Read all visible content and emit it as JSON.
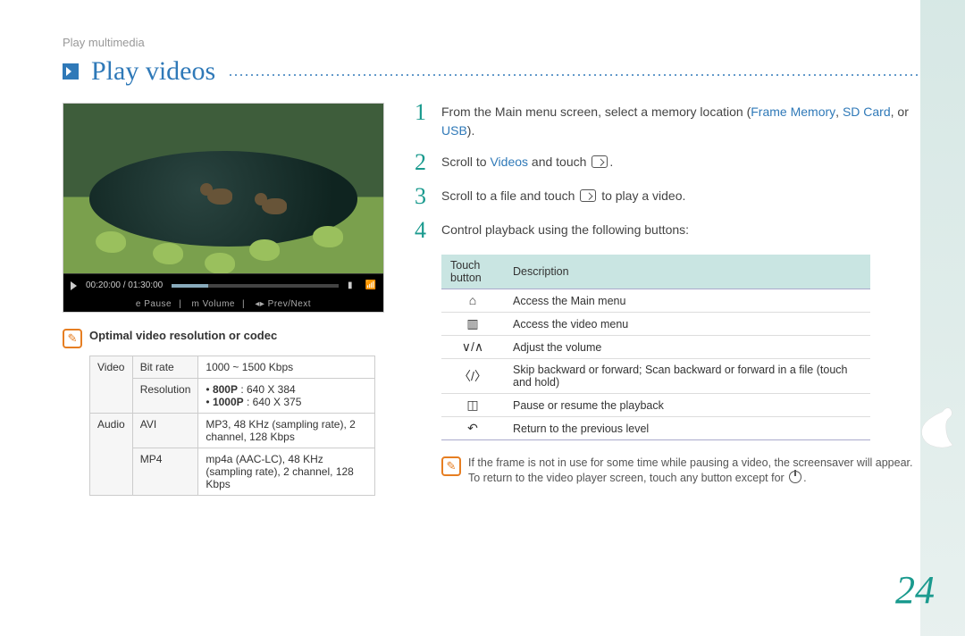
{
  "breadcrumb": "Play multimedia",
  "title": "Play videos",
  "player": {
    "time": "00:20:00 / 01:30:00",
    "hint_pause": "e Pause",
    "hint_volume": "m Volume",
    "hint_prevnext": "◂▸ Prev/Next"
  },
  "codec_note_title": "Optimal video resolution or codec",
  "codec_table": {
    "rows": [
      {
        "cat": "Video",
        "sub": "Bit rate",
        "val": "1000 ~ 1500 Kbps"
      },
      {
        "cat": "",
        "sub": "Resolution",
        "val_html": "• 800P : 640 X 384\n• 1000P : 640 X 375"
      },
      {
        "cat": "Audio",
        "sub": "AVI",
        "val": "MP3, 48 KHz (sampling rate), 2 channel, 128 Kbps"
      },
      {
        "cat": "",
        "sub": "MP4",
        "val": "mp4a (AAC-LC), 48 KHz (sampling rate), 2 channel, 128 Kbps"
      }
    ]
  },
  "steps": [
    {
      "num": "1",
      "pre": "From the Main menu screen, select a memory location (",
      "links": [
        "Frame Memory",
        "SD Card",
        "USB"
      ],
      "join": ", ",
      "or": ", or ",
      "post": ")."
    },
    {
      "num": "2",
      "pre": "Scroll to ",
      "links": [
        "Videos"
      ],
      "post": " and touch ",
      "icon": "enter",
      "tail": "."
    },
    {
      "num": "3",
      "text": "Scroll to a file and touch ",
      "icon": "enter",
      "tail": " to play a video."
    },
    {
      "num": "4",
      "text": "Control playback using the following buttons:"
    }
  ],
  "btn_table": {
    "head": [
      "Touch button",
      "Description"
    ],
    "rows": [
      {
        "icon": "home",
        "glyph": "⌂",
        "desc": "Access the Main menu"
      },
      {
        "icon": "menu",
        "glyph": "▥",
        "desc": "Access the video menu"
      },
      {
        "icon": "updown",
        "glyph": "∨/∧",
        "desc": "Adjust the volume"
      },
      {
        "icon": "prevnext",
        "glyph": "〈/〉",
        "desc": "Skip backward or forward; Scan backward or forward in a file (touch and hold)"
      },
      {
        "icon": "playpause",
        "glyph": "◫",
        "desc": "Pause or resume the playback"
      },
      {
        "icon": "back",
        "glyph": "↶",
        "desc": "Return to the previous level"
      }
    ]
  },
  "screensaver_note": "If the frame is not in use for some time while pausing a video, the screensaver will appear. To return to the video player screen, touch any button except for ",
  "page_number": "24"
}
